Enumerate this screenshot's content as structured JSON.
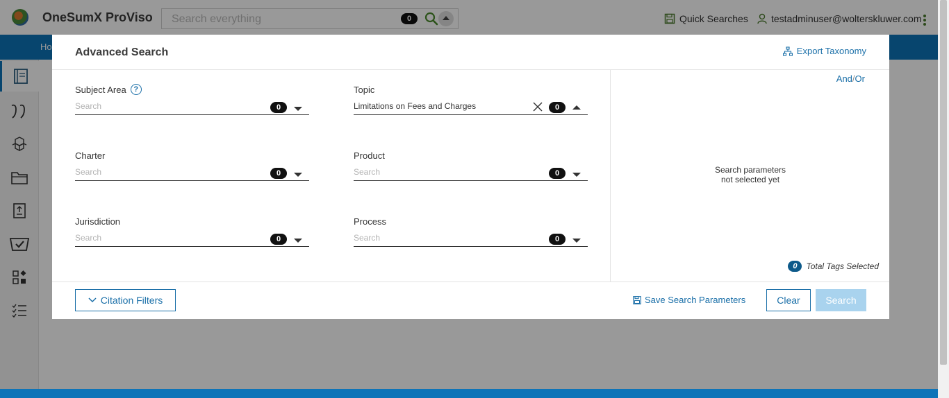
{
  "header": {
    "app_title": "OneSumX ProViso",
    "search": {
      "placeholder": "Search everything",
      "count": "0"
    },
    "quick_searches": "Quick Searches",
    "user_email": "testadminuser@wolterskluwer.com"
  },
  "nav": {
    "home_label": "Ho"
  },
  "modal": {
    "title": "Advanced Search",
    "export_taxonomy": "Export Taxonomy",
    "fields": [
      {
        "label": "Subject Area",
        "placeholder": "Search",
        "value": "",
        "count": "0"
      },
      {
        "label": "Topic",
        "placeholder": "Search",
        "value": "Limitations on Fees and Charges",
        "count": "0"
      },
      {
        "label": "Charter",
        "placeholder": "Search",
        "value": "",
        "count": "0"
      },
      {
        "label": "Product",
        "placeholder": "Search",
        "value": "",
        "count": "0"
      },
      {
        "label": "Jurisdiction",
        "placeholder": "Search",
        "value": "",
        "count": "0"
      },
      {
        "label": "Process",
        "placeholder": "Search",
        "value": "",
        "count": "0"
      }
    ],
    "and_label": "And",
    "separator": "/",
    "or_label": "Or",
    "empty_line1": "Search parameters",
    "empty_line2": "not selected yet",
    "total_tags_count": "0",
    "total_tags_label": "Total Tags Selected",
    "citation_filters": "Citation Filters",
    "save_params": "Save Search Parameters",
    "clear": "Clear",
    "search": "Search"
  },
  "colors": {
    "accent": "#0d74b8",
    "link": "#1a6fa8",
    "search_disabled": "#a9d3ee"
  }
}
